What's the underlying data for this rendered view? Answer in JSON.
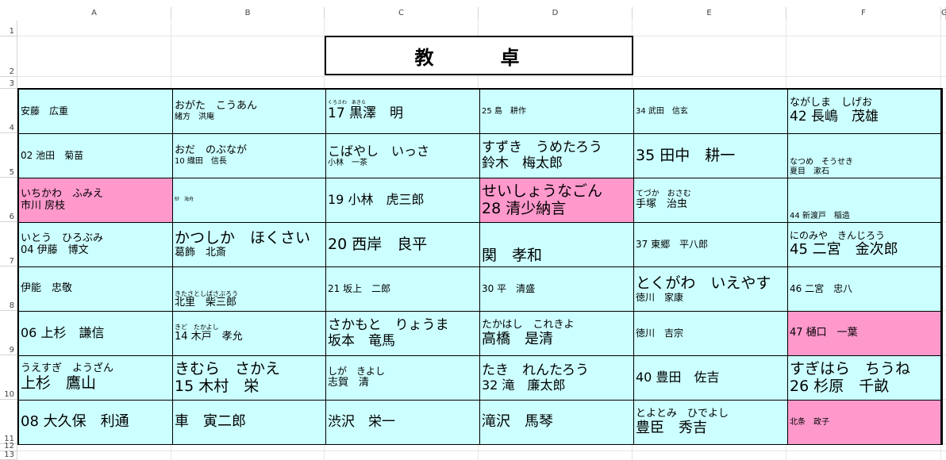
{
  "columns": [
    "A",
    "B",
    "C",
    "D",
    "E",
    "F",
    "G"
  ],
  "rows": [
    "1",
    "2",
    "3",
    "4",
    "5",
    "6",
    "7",
    "8",
    "9",
    "10",
    "11",
    "12",
    "13"
  ],
  "desk_label": "教　卓",
  "seats": [
    {
      "lines": [
        "安藤　広重"
      ],
      "sizes": [
        "s11"
      ]
    },
    {
      "lines": [
        "おがた　こうあん",
        "緒方　洪庵"
      ],
      "sizes": [
        "s13",
        "s9"
      ]
    },
    {
      "lines": [
        "くろさわ　あきら",
        "17 黒澤　明"
      ],
      "sizes": [
        "s6",
        "s17"
      ]
    },
    {
      "lines": [
        "25 島　耕作"
      ],
      "sizes": [
        "s9"
      ]
    },
    {
      "lines": [
        "34 武田　信玄"
      ],
      "sizes": [
        "s9"
      ]
    },
    {
      "lines": [
        "ながしま　しげお",
        "42 長嶋　茂雄"
      ],
      "sizes": [
        "s13",
        "s17"
      ]
    },
    {
      "lines": [
        "02 池田　菊苗"
      ],
      "sizes": [
        "s11"
      ]
    },
    {
      "lines": [
        "おだ　のぶなが",
        "10 織田　信長"
      ],
      "sizes": [
        "s13",
        "s9"
      ]
    },
    {
      "lines": [
        "こばやし　いっさ",
        "小林　一茶"
      ],
      "sizes": [
        "s15",
        "s9"
      ]
    },
    {
      "lines": [
        "すずき　うめたろう",
        "鈴木　梅太郎"
      ],
      "sizes": [
        "s17",
        "s17"
      ]
    },
    {
      "lines": [
        "35 田中　耕一"
      ],
      "sizes": [
        "s19"
      ]
    },
    {
      "lines": [
        "なつめ　そうせき",
        "夏目　漱石"
      ],
      "sizes": [
        "s9",
        "s9"
      ],
      "bottom": true
    },
    {
      "lines": [
        "いちかわ　ふみえ",
        "市川 房枝"
      ],
      "sizes": [
        "s13",
        "s13"
      ],
      "pink": true
    },
    {
      "lines": [
        "紗　海舟"
      ],
      "sizes": [
        "s6"
      ]
    },
    {
      "lines": [
        "19 小林　虎三郎"
      ],
      "sizes": [
        "s15"
      ]
    },
    {
      "lines": [
        "せいしょうなごん",
        "28 清少納言"
      ],
      "sizes": [
        "s19",
        "s19"
      ],
      "pink": true
    },
    {
      "lines": [
        "てづか　おさむ",
        "手塚　治虫"
      ],
      "sizes": [
        "s9",
        "s13"
      ]
    },
    {
      "lines": [
        "44 新渡戸　稲造"
      ],
      "sizes": [
        "s9"
      ],
      "bottom": true
    },
    {
      "lines": [
        "いとう　ひろぶみ",
        "04 伊藤　博文"
      ],
      "sizes": [
        "s13",
        "s13"
      ]
    },
    {
      "lines": [
        "かつしか　ほくさい",
        "葛飾　北斎"
      ],
      "sizes": [
        "s19",
        "s13"
      ]
    },
    {
      "lines": [
        "20 西岸　良平"
      ],
      "sizes": [
        "s19"
      ]
    },
    {
      "lines": [
        "関　孝和"
      ],
      "sizes": [
        "s19"
      ],
      "bottom": true
    },
    {
      "lines": [
        "37 東郷　平八郎"
      ],
      "sizes": [
        "s11"
      ]
    },
    {
      "lines": [
        "にのみや　きんじろう",
        "45 二宮　金次郎"
      ],
      "sizes": [
        "s11",
        "s18"
      ]
    },
    {
      "lines": [
        "伊能　忠敬"
      ],
      "sizes": [
        "s13"
      ]
    },
    {
      "lines": [
        "きたさとしばさぶろう",
        "北里　柴三郎"
      ],
      "sizes": [
        "s7",
        "s13"
      ],
      "bottom": true
    },
    {
      "lines": [
        "21 坂上　二郎"
      ],
      "sizes": [
        "s11"
      ]
    },
    {
      "lines": [
        "30 平　清盛"
      ],
      "sizes": [
        "s11"
      ]
    },
    {
      "lines": [
        "とくがわ　いえやす",
        "徳川　家康"
      ],
      "sizes": [
        "s19",
        "s11"
      ]
    },
    {
      "lines": [
        "46 二宮　忠八"
      ],
      "sizes": [
        "s11"
      ]
    },
    {
      "lines": [
        "06 上杉　謙信"
      ],
      "sizes": [
        "s15"
      ]
    },
    {
      "lines": [
        "きど　たかよし",
        "14 木戸　孝允"
      ],
      "sizes": [
        "s7",
        "s13"
      ]
    },
    {
      "lines": [
        "さかもと　りょうま",
        "坂本　竜馬"
      ],
      "sizes": [
        "s17",
        "s17"
      ]
    },
    {
      "lines": [
        "たかはし　これきよ",
        "高橋　是清"
      ],
      "sizes": [
        "s13",
        "s18"
      ]
    },
    {
      "lines": [
        "徳川　吉宗"
      ],
      "sizes": [
        "s11"
      ]
    },
    {
      "lines": [
        "47 樋口　一葉"
      ],
      "sizes": [
        "s13"
      ],
      "pink": true
    },
    {
      "lines": [
        "うえすぎ　ようざん",
        "上杉　鷹山"
      ],
      "sizes": [
        "s13",
        "s19"
      ]
    },
    {
      "lines": [
        "きむら　さかえ",
        "15 木村　栄"
      ],
      "sizes": [
        "s19",
        "s19"
      ]
    },
    {
      "lines": [
        "しが　きよし",
        "志賀　清"
      ],
      "sizes": [
        "s11",
        "s13"
      ]
    },
    {
      "lines": [
        "たき　れんたろう",
        "32 滝　廉太郎"
      ],
      "sizes": [
        "s17",
        "s15"
      ]
    },
    {
      "lines": [
        "40 豊田　佐吉"
      ],
      "sizes": [
        "s15"
      ]
    },
    {
      "lines": [
        "すぎはら　ちうね",
        "26 杉原　千畝"
      ],
      "sizes": [
        "s19",
        "s19"
      ]
    },
    {
      "lines": [
        "08 大久保　利通"
      ],
      "sizes": [
        "s18"
      ]
    },
    {
      "lines": [
        "車　寅二郎"
      ],
      "sizes": [
        "s18"
      ]
    },
    {
      "lines": [
        "渋沢　栄一"
      ],
      "sizes": [
        "s17"
      ]
    },
    {
      "lines": [
        "滝沢　馬琴"
      ],
      "sizes": [
        "s18"
      ]
    },
    {
      "lines": [
        "とよとみ　ひでよし",
        "豊臣　秀吉"
      ],
      "sizes": [
        "s13",
        "s18"
      ]
    },
    {
      "lines": [
        "北条　政子"
      ],
      "sizes": [
        "s9"
      ],
      "pink": true
    }
  ]
}
